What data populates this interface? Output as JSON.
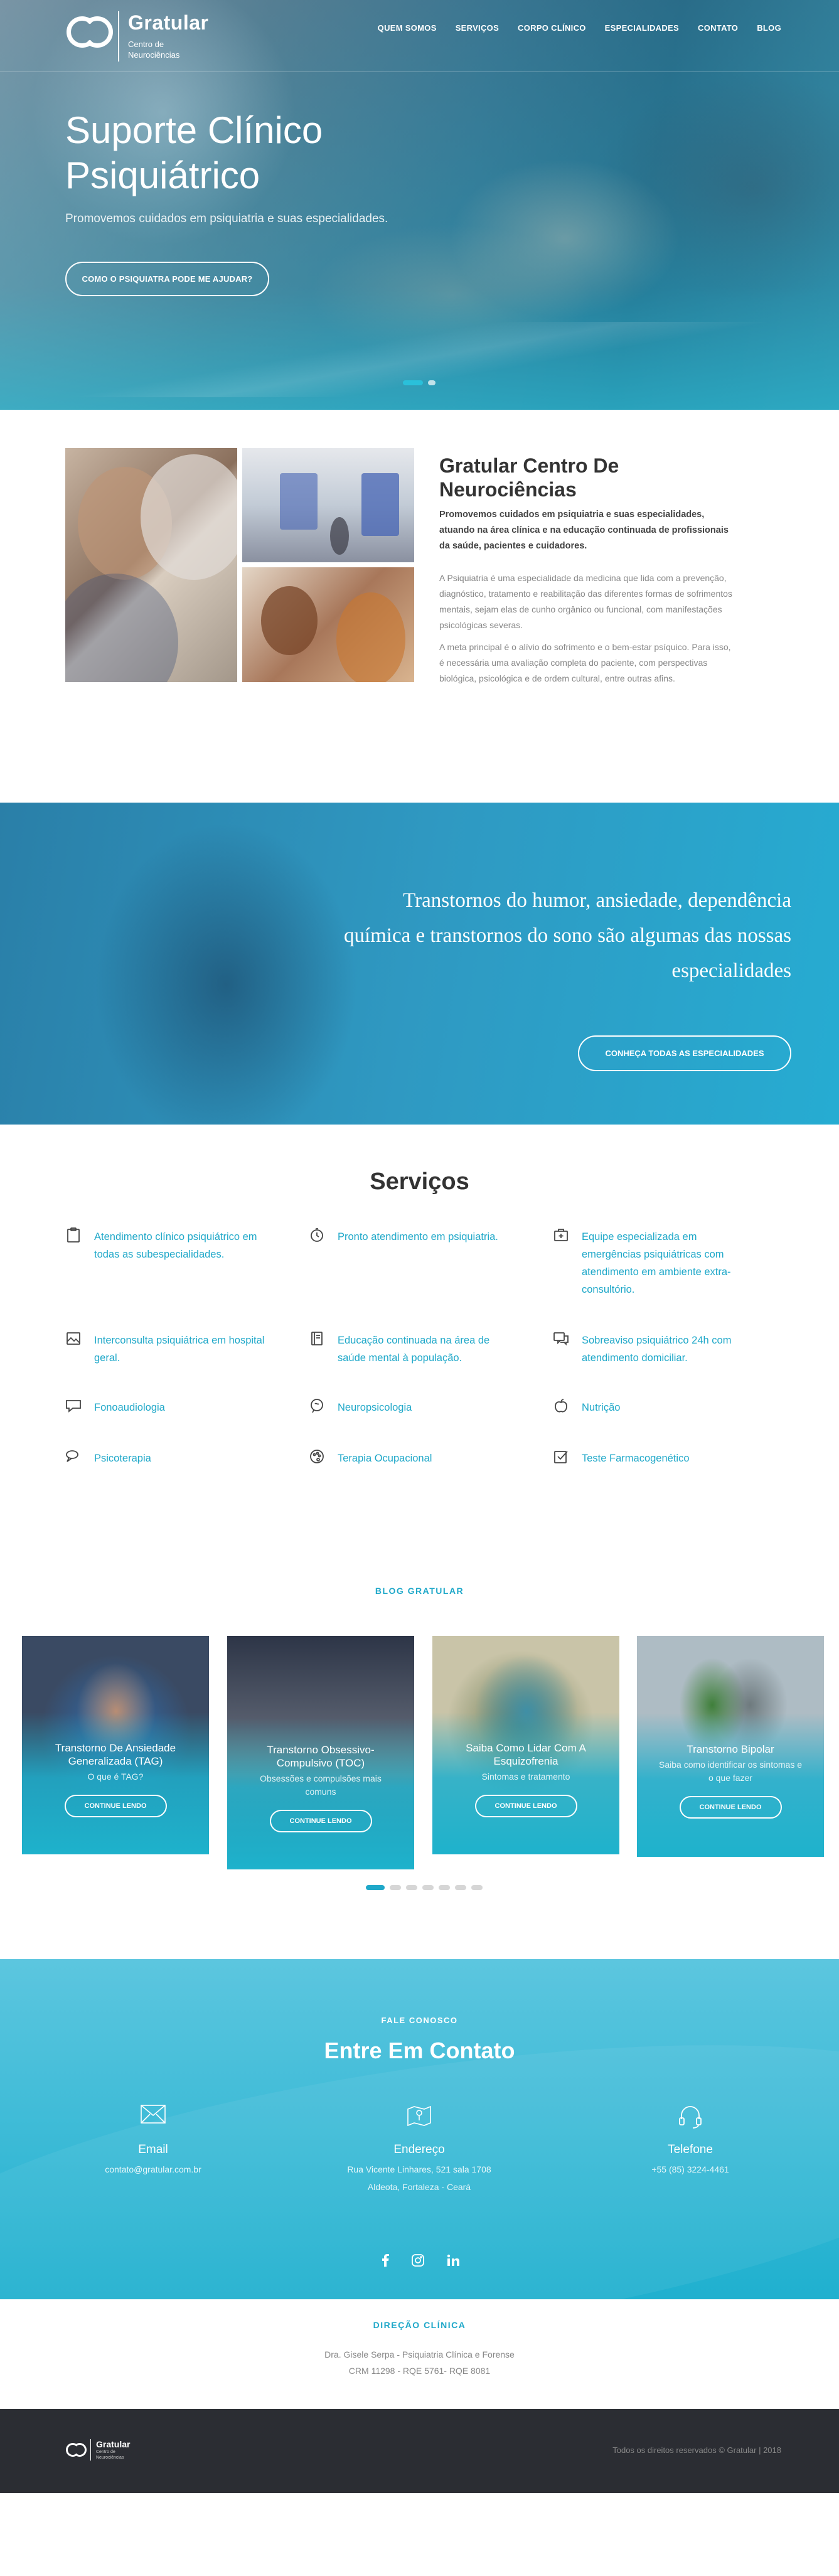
{
  "brand": {
    "name": "Gratular",
    "tagline": "Centro de Neurociências"
  },
  "nav": {
    "items": [
      "QUEM SOMOS",
      "SERVIÇOS",
      "CORPO CLÍNICO",
      "ESPECIALIDADES",
      "CONTATO",
      "BLOG"
    ]
  },
  "hero": {
    "title": "Suporte Clínico Psiquiátrico",
    "subtitle": "Promovemos cuidados em psiquiatria e suas especialidades.",
    "button": "COMO O PSIQUIATRA PODE ME AJUDAR?",
    "slides": 2,
    "active_slide": 1
  },
  "about": {
    "title": "Gratular Centro De Neurociências",
    "lead": "Promovemos cuidados em psiquiatria e suas especialidades, atuando na área clínica e na educação continuada de profissionais da saúde, pacientes e cuidadores.",
    "p1": "A Psiquiatria é uma especialidade da medicina que lida com a prevenção, diagnóstico, tratamento e reabilitação das diferentes formas de sofrimentos mentais, sejam elas de cunho orgânico ou funcional, com manifestações psicológicas severas.",
    "p2": "A meta principal é o alívio do sofrimento e o bem-estar psíquico. Para isso, é necessária uma avaliação completa do paciente, com perspectivas biológica, psicológica e de ordem cultural, entre outras afins."
  },
  "specialties": {
    "text": "Transtornos do humor, ansiedade, dependência química e transtornos do sono são algumas das nossas especialidades",
    "button": "CONHEÇA TODAS AS ESPECIALIDADES"
  },
  "services": {
    "title": "Serviços",
    "items": [
      {
        "label": "Atendimento clínico psiquiátrico em todas as subespecialidades.",
        "icon": "clipboard-icon"
      },
      {
        "label": "Pronto atendimento em psiquiatria.",
        "icon": "stopwatch-icon"
      },
      {
        "label": "Equipe especializada em emergências psiquiátricas com atendimento em ambiente extra-consultório.",
        "icon": "first-aid-icon"
      },
      {
        "label": "Interconsulta psiquiátrica em hospital geral.",
        "icon": "picture-icon"
      },
      {
        "label": "Educação continuada na área de saúde mental à população.",
        "icon": "book-icon"
      },
      {
        "label": "Sobreaviso psiquiátrico 24h com atendimento domiciliar.",
        "icon": "chat-icon"
      },
      {
        "label": "Fonoaudiologia",
        "icon": "speech-icon"
      },
      {
        "label": "Neuropsicologia",
        "icon": "brain-icon"
      },
      {
        "label": "Nutrição",
        "icon": "apple-icon"
      },
      {
        "label": "Psicoterapia",
        "icon": "talk-icon"
      },
      {
        "label": "Terapia Ocupacional",
        "icon": "palette-icon"
      },
      {
        "label": "Teste Farmacogenético",
        "icon": "checkbox-icon"
      }
    ]
  },
  "blog": {
    "label": "BLOG GRATULAR",
    "cards": [
      {
        "title": "Transtorno De Ansiedade Generalizada (TAG)",
        "subtitle": "O que é TAG?",
        "button": "CONTINUE LENDO"
      },
      {
        "title": "Transtorno Obsessivo-Compulsivo (TOC)",
        "subtitle": "Obsessões e compulsões mais comuns",
        "button": "CONTINUE LENDO"
      },
      {
        "title": "Saiba Como Lidar Com A Esquizofrenia",
        "subtitle": "Sintomas e tratamento",
        "button": "CONTINUE LENDO"
      },
      {
        "title": "Transtorno Bipolar",
        "subtitle": "Saiba como identificar os sintomas e o que fazer",
        "button": "CONTINUE LENDO"
      }
    ],
    "pages": 7,
    "active_page": 1
  },
  "contact": {
    "label": "FALE CONOSCO",
    "title": "Entre Em Contato",
    "email": {
      "heading": "Email",
      "value": "contato@gratular.com.br",
      "icon": "envelope-icon"
    },
    "address": {
      "heading": "Endereço",
      "line1": "Rua Vicente Linhares, 521 sala 1708",
      "line2": "Aldeota, Fortaleza - Ceará",
      "icon": "map-icon"
    },
    "phone": {
      "heading": "Telefone",
      "value": "+55 (85) 3224-4461",
      "icon": "headset-icon"
    },
    "social": [
      "facebook-icon",
      "instagram-icon",
      "linkedin-icon"
    ]
  },
  "direction": {
    "label": "DIREÇÃO CLÍNICA",
    "line1": "Dra. Gisele Serpa - Psiquiatria Clínica e Forense",
    "line2": "CRM 11298 - RQE 5761- RQE 8081"
  },
  "footer": {
    "copyright": "Todos os direitos reservados © Gratular | 2018"
  }
}
